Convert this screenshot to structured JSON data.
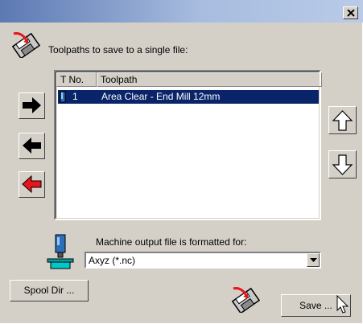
{
  "window": {
    "close_glyph": "×"
  },
  "heading": {
    "text": "Toolpaths to save to a single file:",
    "icon": "save-to-file-icon"
  },
  "toolpath_list": {
    "columns": [
      "T No.",
      "Toolpath"
    ],
    "rows": [
      {
        "t_no": "1",
        "toolpath": "Area Clear - End Mill 12mm",
        "selected": true,
        "icon": "end-mill-icon"
      }
    ]
  },
  "buttons": {
    "add_right": "arrow-right-icon",
    "remove_left": "arrow-left-icon",
    "remove_all_left": "arrow-left-red-icon",
    "move_up": "arrow-up-icon",
    "move_down": "arrow-down-icon",
    "spool_dir": "Spool Dir ...",
    "save": "Save ..."
  },
  "machine": {
    "label": "Machine output file is formatted for:",
    "selected_format": "Axyz (*.nc)"
  },
  "colors": {
    "title_gradient_start": "#5c79b3",
    "selection": "#0a246a",
    "dialog_bg": "#d4d0c8",
    "red_arrow": "#e8141c"
  }
}
